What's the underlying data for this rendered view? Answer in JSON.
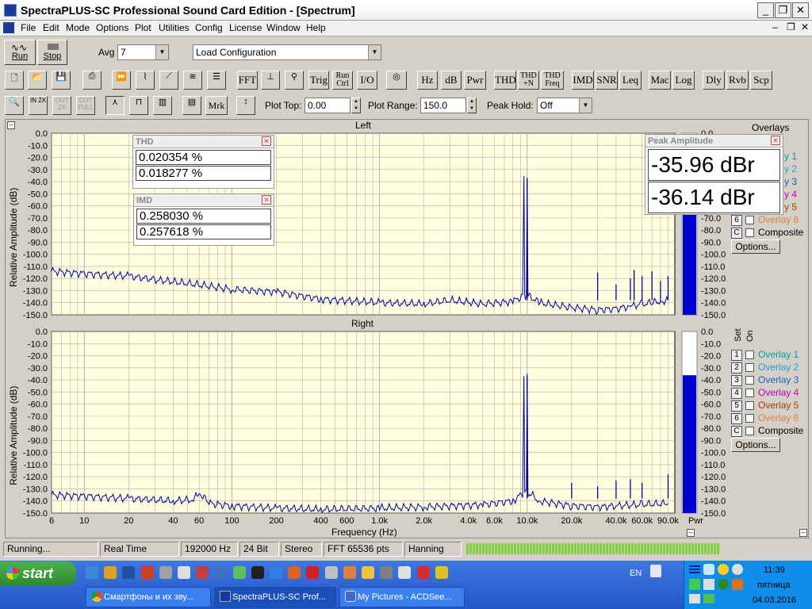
{
  "window": {
    "title": "SpectraPLUS-SC Professional Sound Card Edition - [Spectrum]",
    "btns": [
      "_",
      "❐",
      "✕"
    ]
  },
  "menu": [
    "File",
    "Edit",
    "Mode",
    "Options",
    "Plot",
    "Utilities",
    "Config",
    "License",
    "Window",
    "Help"
  ],
  "toolbar1": {
    "run": "Run",
    "stop": "Stop",
    "avg_label": "Avg",
    "avg_value": "7",
    "config_value": "Load Configuration"
  },
  "toolbar2": {
    "text_buttons": [
      "FFT",
      "Trig",
      "Run Ctrl",
      "I/O",
      "Hz",
      "dB",
      "Pwr",
      "THD",
      "THD +N",
      "THD Freq",
      "IMD",
      "SNR",
      "Leq",
      "Mac",
      "Log",
      "Dly",
      "Rvb",
      "Scp"
    ]
  },
  "toolbar3": {
    "mrk": "Mrk",
    "plot_top_label": "Plot Top:",
    "plot_top_value": "0.00",
    "plot_range_label": "Plot Range:",
    "plot_range_value": "150.0",
    "peak_hold_label": "Peak Hold:",
    "peak_hold_value": "Off"
  },
  "left": {
    "title": "Left",
    "ylabel": "Relative Amplitude (dB)"
  },
  "right": {
    "title": "Right",
    "ylabel": "Relative Amplitude (dB)",
    "xlabel": "Frequency (Hz)"
  },
  "thd": {
    "title": "THD",
    "v1": "0.020354 %",
    "v2": "0.018277 %"
  },
  "imd": {
    "title": "IMD",
    "v1": "0.258030 %",
    "v2": "0.257618 %"
  },
  "peak": {
    "title": "Peak Amplitude",
    "v1": "-35.96 dBr",
    "v2": "-36.14 dBr"
  },
  "overlays": {
    "title": "Overlays",
    "set": "Set",
    "on": "On",
    "items": [
      {
        "n": "1",
        "label": "Overlay 1",
        "color": "#00a0a0"
      },
      {
        "n": "2",
        "label": "Overlay 2",
        "color": "#20a0d0"
      },
      {
        "n": "3",
        "label": "Overlay 3",
        "color": "#2060c0"
      },
      {
        "n": "4",
        "label": "Overlay 4",
        "color": "#c000c0"
      },
      {
        "n": "5",
        "label": "Overlay 5",
        "color": "#a04000"
      },
      {
        "n": "6",
        "label": "Overlay 6",
        "color": "#e08040"
      }
    ],
    "composite_n": "C",
    "composite": "Composite",
    "options": "Options...",
    "left_partial": [
      "y 1",
      "y 2",
      "y 3",
      "y 4",
      "y 5"
    ],
    "left_visible_btn": "6",
    "left_visible_label": "Overlay 6"
  },
  "bar": {
    "pwr": "Pwr"
  },
  "status": {
    "state": "Running...",
    "mode": "Real Time",
    "rate": "192000 Hz",
    "bits": "24 Bit",
    "chan": "Stereo",
    "fft": "FFT 65536 pts",
    "window": "Hanning"
  },
  "taskbar": {
    "start": "start",
    "tasks": [
      "Смартфоны и их зву...",
      "SpectraPLUS-SC Prof...",
      "My Pictures - ACDSee..."
    ],
    "lang": "EN",
    "time": "11:39",
    "day": "пятница",
    "date": "04.03.2016"
  },
  "chart_data": [
    {
      "type": "line",
      "title": "Left",
      "ylabel": "Relative Amplitude (dB)",
      "xscale": "log",
      "xlim": [
        6,
        100000
      ],
      "ylim": [
        -150,
        0
      ],
      "yticks": [
        "0.0",
        "-10.0",
        "-20.0",
        "-30.0",
        "-40.0",
        "-50.0",
        "-60.0",
        "-70.0",
        "-80.0",
        "-90.0",
        "-100.0",
        "-110.0",
        "-120.0",
        "-130.0",
        "-140.0",
        "-150.0"
      ],
      "grid": true,
      "series": [
        {
          "x": [
            6,
            10,
            20,
            30,
            50,
            100,
            200,
            400,
            1000,
            2000,
            3000,
            5000,
            8000,
            9500,
            10000,
            10500,
            12000,
            20000,
            30000,
            40000,
            50000,
            60000,
            70000,
            80000,
            90000
          ],
          "y": [
            -114,
            -116,
            -118,
            -121,
            -124,
            -129,
            -131,
            -137,
            -140,
            -141,
            -138,
            -141,
            -139,
            -134,
            -37,
            -135,
            -140,
            -144,
            -146,
            -145,
            -143,
            -141,
            -140,
            -139,
            -138
          ]
        }
      ],
      "spikes": [
        {
          "x": 10000,
          "y": -37
        },
        {
          "x": 30000,
          "y": -115
        },
        {
          "x": 40000,
          "y": -125
        },
        {
          "x": 50000,
          "y": -120
        },
        {
          "x": 53000,
          "y": -113
        },
        {
          "x": 60000,
          "y": -118
        },
        {
          "x": 70000,
          "y": -114
        },
        {
          "x": 80000,
          "y": -122
        },
        {
          "x": 90000,
          "y": -118
        }
      ]
    },
    {
      "type": "line",
      "title": "Right",
      "ylabel": "Relative Amplitude (dB)",
      "xlabel": "Frequency (Hz)",
      "xscale": "log",
      "xlim": [
        6,
        100000
      ],
      "ylim": [
        -150,
        0
      ],
      "yticks": [
        "0.0",
        "-10.0",
        "-20.0",
        "-30.0",
        "-40.0",
        "-50.0",
        "-60.0",
        "-70.0",
        "-80.0",
        "-90.0",
        "-100.0",
        "-110.0",
        "-120.0",
        "-130.0",
        "-140.0",
        "-150.0"
      ],
      "xticks": [
        "6",
        "10",
        "20",
        "40",
        "60",
        "100",
        "200",
        "400",
        "600",
        "1.0k",
        "2.0k",
        "4.0k",
        "6.0k",
        "10.0k",
        "20.0k",
        "40.0k",
        "60.0k",
        "90.0k"
      ],
      "xtick_vals": [
        6,
        10,
        20,
        40,
        60,
        100,
        200,
        400,
        600,
        1000,
        2000,
        4000,
        6000,
        10000,
        20000,
        40000,
        60000,
        90000
      ],
      "grid": true,
      "series": [
        {
          "x": [
            6,
            10,
            20,
            40,
            55,
            60,
            70,
            100,
            200,
            400,
            1000,
            2000,
            5000,
            8000,
            9500,
            10000,
            10500,
            12000,
            20000,
            30000,
            40000,
            60000,
            90000
          ],
          "y": [
            -135,
            -136,
            -138,
            -140,
            -139,
            -133,
            -142,
            -144,
            -146,
            -147,
            -146,
            -145,
            -143,
            -140,
            -133,
            -37,
            -134,
            -140,
            -144,
            -145,
            -144,
            -143,
            -142
          ]
        }
      ],
      "spikes": [
        {
          "x": 10000,
          "y": -37
        },
        {
          "x": 20000,
          "y": -125
        },
        {
          "x": 30000,
          "y": -128
        },
        {
          "x": 40000,
          "y": -123
        },
        {
          "x": 50000,
          "y": -122
        },
        {
          "x": 60000,
          "y": -125
        },
        {
          "x": 90000,
          "y": -118
        }
      ]
    }
  ]
}
